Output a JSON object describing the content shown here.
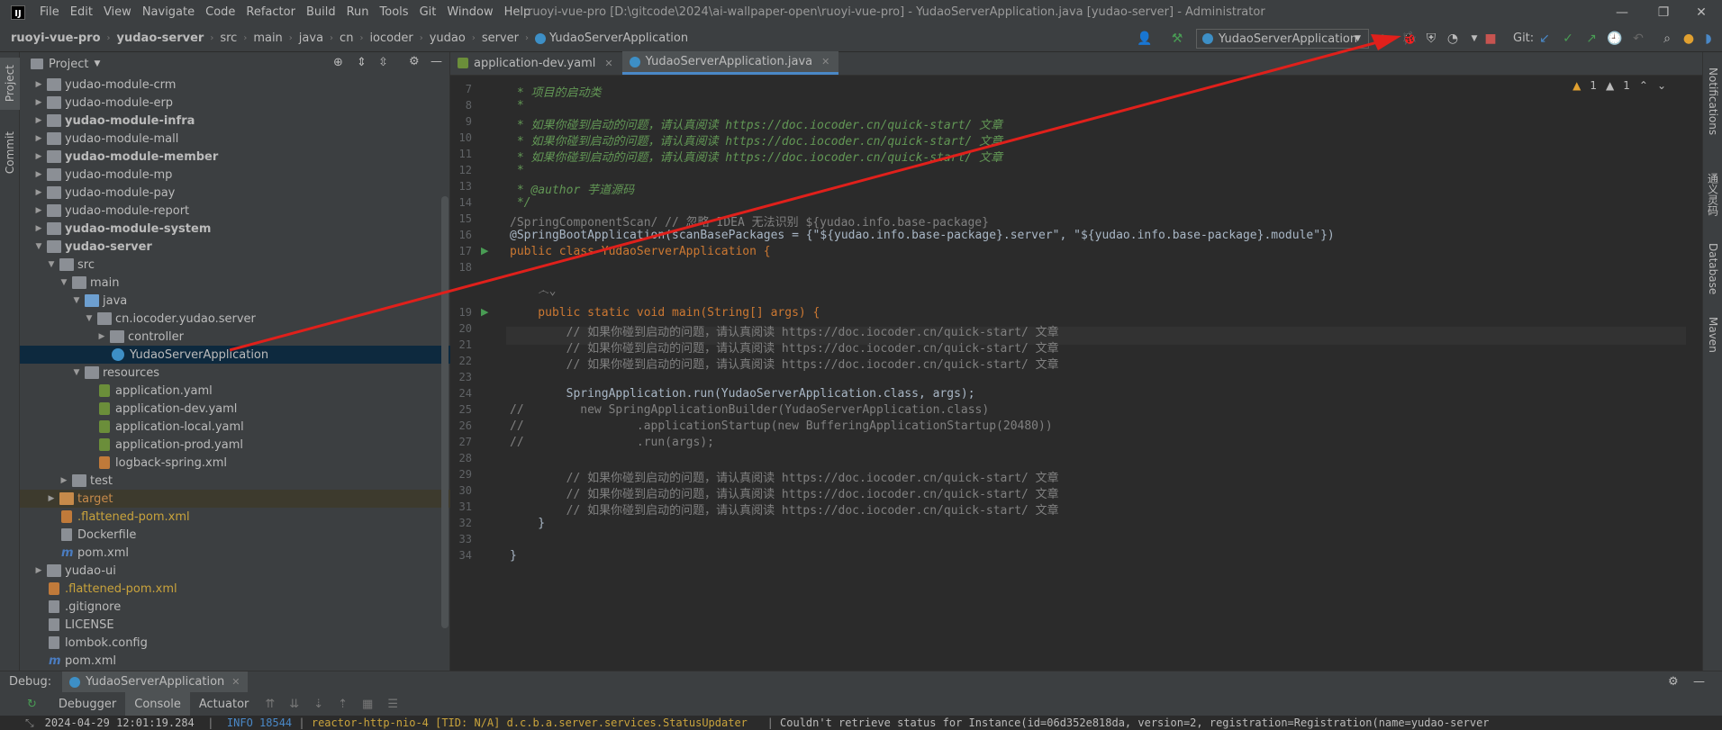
{
  "menu": [
    "File",
    "Edit",
    "View",
    "Navigate",
    "Code",
    "Refactor",
    "Build",
    "Run",
    "Tools",
    "Git",
    "Window",
    "Help"
  ],
  "window_title": "ruoyi-vue-pro [D:\\gitcode\\2024\\ai-wallpaper-open\\ruoyi-vue-pro] - YudaoServerApplication.java [yudao-server] - Administrator",
  "breadcrumb": [
    "ruoyi-vue-pro",
    "yudao-server",
    "src",
    "main",
    "java",
    "cn",
    "iocoder",
    "yudao",
    "server",
    "YudaoServerApplication"
  ],
  "run_config": "YudaoServerApplication",
  "git_label": "Git:",
  "left_strip": {
    "project": "Project",
    "commit": "Commit"
  },
  "right_strip": {
    "notifications": "Notifications",
    "database": "Database",
    "maven": "Maven",
    "extra": "通义灵码"
  },
  "project_panel": {
    "title": "Project"
  },
  "tree": [
    {
      "label": "yudao-module-crm",
      "indent": 1,
      "arrow": "right",
      "icon": "folder",
      "style": ""
    },
    {
      "label": "yudao-module-erp",
      "indent": 1,
      "arrow": "right",
      "icon": "folder",
      "style": ""
    },
    {
      "label": "yudao-module-infra",
      "indent": 1,
      "arrow": "right",
      "icon": "folder",
      "style": "bold"
    },
    {
      "label": "yudao-module-mall",
      "indent": 1,
      "arrow": "right",
      "icon": "folder",
      "style": ""
    },
    {
      "label": "yudao-module-member",
      "indent": 1,
      "arrow": "right",
      "icon": "folder",
      "style": "bold"
    },
    {
      "label": "yudao-module-mp",
      "indent": 1,
      "arrow": "right",
      "icon": "folder",
      "style": ""
    },
    {
      "label": "yudao-module-pay",
      "indent": 1,
      "arrow": "right",
      "icon": "folder",
      "style": ""
    },
    {
      "label": "yudao-module-report",
      "indent": 1,
      "arrow": "right",
      "icon": "folder",
      "style": ""
    },
    {
      "label": "yudao-module-system",
      "indent": 1,
      "arrow": "right",
      "icon": "folder",
      "style": "bold"
    },
    {
      "label": "yudao-server",
      "indent": 1,
      "arrow": "down",
      "icon": "folder",
      "style": "bold"
    },
    {
      "label": "src",
      "indent": 2,
      "arrow": "down",
      "icon": "folder",
      "style": ""
    },
    {
      "label": "main",
      "indent": 3,
      "arrow": "down",
      "icon": "folder",
      "style": ""
    },
    {
      "label": "java",
      "indent": 4,
      "arrow": "down",
      "icon": "folder-blue",
      "style": ""
    },
    {
      "label": "cn.iocoder.yudao.server",
      "indent": 5,
      "arrow": "down",
      "icon": "folder",
      "style": ""
    },
    {
      "label": "controller",
      "indent": 6,
      "arrow": "right",
      "icon": "folder",
      "style": ""
    },
    {
      "label": "YudaoServerApplication",
      "indent": 6,
      "arrow": "",
      "icon": "class",
      "style": "",
      "selected": true
    },
    {
      "label": "resources",
      "indent": 4,
      "arrow": "down",
      "icon": "folder",
      "style": ""
    },
    {
      "label": "application.yaml",
      "indent": 5,
      "arrow": "",
      "icon": "yaml",
      "style": ""
    },
    {
      "label": "application-dev.yaml",
      "indent": 5,
      "arrow": "",
      "icon": "yaml",
      "style": ""
    },
    {
      "label": "application-local.yaml",
      "indent": 5,
      "arrow": "",
      "icon": "yaml",
      "style": ""
    },
    {
      "label": "application-prod.yaml",
      "indent": 5,
      "arrow": "",
      "icon": "yaml",
      "style": ""
    },
    {
      "label": "logback-spring.xml",
      "indent": 5,
      "arrow": "",
      "icon": "xml",
      "style": ""
    },
    {
      "label": "test",
      "indent": 3,
      "arrow": "right",
      "icon": "folder",
      "style": ""
    },
    {
      "label": "target",
      "indent": 2,
      "arrow": "right",
      "icon": "folder-orange",
      "style": "orange",
      "highlight": true
    },
    {
      "label": ".flattened-pom.xml",
      "indent": 2,
      "arrow": "",
      "icon": "xml",
      "style": "yellow"
    },
    {
      "label": "Dockerfile",
      "indent": 2,
      "arrow": "",
      "icon": "generic",
      "style": ""
    },
    {
      "label": "pom.xml",
      "indent": 2,
      "arrow": "",
      "icon": "m",
      "style": ""
    },
    {
      "label": "yudao-ui",
      "indent": 1,
      "arrow": "right",
      "icon": "folder",
      "style": ""
    },
    {
      "label": ".flattened-pom.xml",
      "indent": 1,
      "arrow": "",
      "icon": "xml",
      "style": "yellow"
    },
    {
      "label": ".gitignore",
      "indent": 1,
      "arrow": "",
      "icon": "generic",
      "style": ""
    },
    {
      "label": "LICENSE",
      "indent": 1,
      "arrow": "",
      "icon": "generic",
      "style": ""
    },
    {
      "label": "lombok.config",
      "indent": 1,
      "arrow": "",
      "icon": "generic",
      "style": ""
    },
    {
      "label": "pom.xml",
      "indent": 1,
      "arrow": "",
      "icon": "m",
      "style": ""
    }
  ],
  "editor_tabs": [
    {
      "label": "application-dev.yaml",
      "active": false
    },
    {
      "label": "YudaoServerApplication.java",
      "active": true
    }
  ],
  "inspections": {
    "warnings": "1",
    "weak": "1"
  },
  "code_lines": [
    {
      "n": "7",
      "text": " * 项目的启动类",
      "cls": "cm"
    },
    {
      "n": "8",
      "text": " *",
      "cls": "cm"
    },
    {
      "n": "9",
      "text": " * 如果你碰到启动的问题，请认真阅读 https://doc.iocoder.cn/quick-start/ 文章",
      "cls": "cm"
    },
    {
      "n": "10",
      "text": " * 如果你碰到启动的问题，请认真阅读 https://doc.iocoder.cn/quick-start/ 文章",
      "cls": "cm"
    },
    {
      "n": "11",
      "text": " * 如果你碰到启动的问题，请认真阅读 https://doc.iocoder.cn/quick-start/ 文章",
      "cls": "cm"
    },
    {
      "n": "12",
      "text": " *",
      "cls": "cm"
    },
    {
      "n": "13",
      "text": " * @author 芋道源码",
      "cls": "cm"
    },
    {
      "n": "14",
      "text": " */",
      "cls": "cm"
    },
    {
      "n": "15",
      "text": "/SpringComponentScan/ // 忽略 IDEA 无法识别 ${yudao.info.base-package}",
      "cls": "lc"
    },
    {
      "n": "16",
      "text": "@SpringBootApplication(scanBasePackages = {\"${yudao.info.base-package}.server\", \"${yudao.info.base-package}.module\"})",
      "cls": "an"
    },
    {
      "n": "17",
      "text": "public class YudaoServerApplication {",
      "cls": "kwline"
    },
    {
      "n": "18",
      "text": "",
      "cls": ""
    },
    {
      "n": "",
      "text": "    ෴⌄",
      "cls": "lc"
    },
    {
      "n": "19",
      "text": "    public static void main(String[] args) {",
      "cls": "kwline2"
    },
    {
      "n": "20",
      "text": "        // 如果你碰到启动的问题，请认真阅读 https://doc.iocoder.cn/quick-start/ 文章",
      "cls": "lc"
    },
    {
      "n": "21",
      "text": "        // 如果你碰到启动的问题，请认真阅读 https://doc.iocoder.cn/quick-start/ 文章",
      "cls": "lc"
    },
    {
      "n": "22",
      "text": "        // 如果你碰到启动的问题，请认真阅读 https://doc.iocoder.cn/quick-start/ 文章",
      "cls": "lc"
    },
    {
      "n": "23",
      "text": "",
      "cls": ""
    },
    {
      "n": "24",
      "text": "        SpringApplication.run(YudaoServerApplication.class, args);",
      "cls": ""
    },
    {
      "n": "25",
      "text": "//        new SpringApplicationBuilder(YudaoServerApplication.class)",
      "cls": "lc"
    },
    {
      "n": "26",
      "text": "//                .applicationStartup(new BufferingApplicationStartup(20480))",
      "cls": "lc"
    },
    {
      "n": "27",
      "text": "//                .run(args);",
      "cls": "lc"
    },
    {
      "n": "28",
      "text": "",
      "cls": ""
    },
    {
      "n": "29",
      "text": "        // 如果你碰到启动的问题，请认真阅读 https://doc.iocoder.cn/quick-start/ 文章",
      "cls": "lc"
    },
    {
      "n": "30",
      "text": "        // 如果你碰到启动的问题，请认真阅读 https://doc.iocoder.cn/quick-start/ 文章",
      "cls": "lc"
    },
    {
      "n": "31",
      "text": "        // 如果你碰到启动的问题，请认真阅读 https://doc.iocoder.cn/quick-start/ 文章",
      "cls": "lc"
    },
    {
      "n": "32",
      "text": "    }",
      "cls": ""
    },
    {
      "n": "33",
      "text": "",
      "cls": ""
    },
    {
      "n": "34",
      "text": "}",
      "cls": ""
    }
  ],
  "debug": {
    "label": "Debug:",
    "session": "YudaoServerApplication"
  },
  "debug_tabs": [
    "Debugger",
    "Console",
    "Actuator"
  ],
  "console": {
    "time": "2024-04-29 12:01:19.284",
    "level": "INFO 18544",
    "thread": "reactor-http-nio-4 [TID: N/A] d.c.b.a.server.services.StatusUpdater",
    "message": "Couldn't retrieve status for Instance(id=06d352e818da, version=2, registration=Registration(name=yudao-server"
  },
  "colors": {
    "accent": "#4a88c7",
    "arrow": "#e0201b",
    "run": "#499c54",
    "stop": "#c75450"
  }
}
